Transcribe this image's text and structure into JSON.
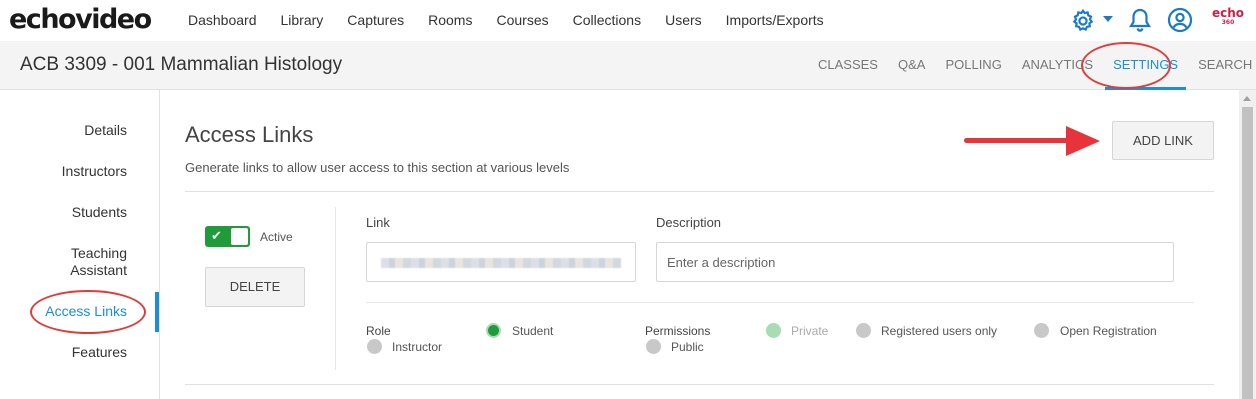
{
  "app": {
    "logo": "echovideo",
    "nav": [
      "Dashboard",
      "Library",
      "Captures",
      "Rooms",
      "Courses",
      "Collections",
      "Users",
      "Imports/Exports"
    ],
    "brand_logo": "echo",
    "brand_logo_sub": "360",
    "accent_color": "#1a8ed6"
  },
  "course": {
    "title": "ACB 3309 - 001 Mammalian Histology",
    "tabs": [
      "CLASSES",
      "Q&A",
      "POLLING",
      "ANALYTICS",
      "SETTINGS",
      "SEARCH"
    ],
    "active_tab": "SETTINGS"
  },
  "sidebar": {
    "items": [
      "Details",
      "Instructors",
      "Students",
      "Teaching Assistant",
      "Access Links",
      "Features"
    ],
    "active": "Access Links"
  },
  "main": {
    "title": "Access Links",
    "subtitle": "Generate links to allow user access to this section at various levels",
    "add_button": "ADD LINK"
  },
  "link_entry": {
    "active_label": "Active",
    "active": true,
    "delete_button": "DELETE",
    "link_label": "Link",
    "description_label": "Description",
    "description_placeholder": "Enter a description",
    "role_label": "Role",
    "roles": [
      "Student",
      "Instructor"
    ],
    "selected_role": "Student",
    "permissions_label": "Permissions",
    "permissions": [
      "Private",
      "Registered users only",
      "Open Registration",
      "Public"
    ],
    "selected_permission": "Private",
    "permission_disabled": "Private"
  },
  "annotation_color": "#e03c3c"
}
